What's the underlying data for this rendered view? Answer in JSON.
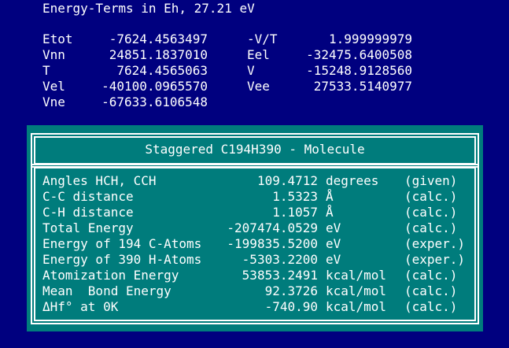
{
  "header": {
    "title": "Energy-Terms in Eh, 27.21 eV",
    "left": [
      {
        "label": "Etot",
        "value": "-7624.4563497"
      },
      {
        "label": "Vnn",
        "value": "24851.1837010"
      },
      {
        "label": "T",
        "value": "7624.4565063"
      },
      {
        "label": "Vel",
        "value": "-40100.0965570"
      },
      {
        "label": "Vne",
        "value": "-67633.6106548"
      }
    ],
    "right": [
      {
        "label": "-V/T",
        "value": "1.999999979"
      },
      {
        "label": "Eel",
        "value": "-32475.6400508"
      },
      {
        "label": "V",
        "value": "-15248.9128560"
      },
      {
        "label": "Vee",
        "value": "27533.5140977"
      }
    ]
  },
  "panel": {
    "title": "Staggered C194H390 - Molecule",
    "rows": [
      {
        "label": "Angles HCH, CCH",
        "value": "109.4712",
        "unit": "degrees",
        "note": "(given)"
      },
      {
        "label": "C-C distance",
        "value": "1.5323",
        "unit": "Å",
        "note": "(calc.)"
      },
      {
        "label": "C-H distance",
        "value": "1.1057",
        "unit": "Å",
        "note": "(calc.)"
      },
      {
        "label": "Total Energy",
        "value": "-207474.0529",
        "unit": "eV",
        "note": "(calc.)"
      },
      {
        "label": "Energy of 194 C-Atoms",
        "value": "-199835.5200",
        "unit": "eV",
        "note": "(exper.)"
      },
      {
        "label": "Energy of 390 H-Atoms",
        "value": "-5303.2200",
        "unit": "eV",
        "note": "(exper.)"
      },
      {
        "label": "Atomization Energy",
        "value": "53853.2491",
        "unit": "kcal/mol",
        "note": "(calc.)"
      },
      {
        "label": "Mean  Bond Energy",
        "value": "92.3726",
        "unit": "kcal/mol",
        "note": "(calc.)"
      },
      {
        "label": "ΔHf° at 0K",
        "value": "-740.90",
        "unit": "kcal/mol",
        "note": "(calc.)"
      }
    ]
  },
  "colors": {
    "background": "#00007f",
    "panel": "#007c7c",
    "text": "#ffffff"
  }
}
